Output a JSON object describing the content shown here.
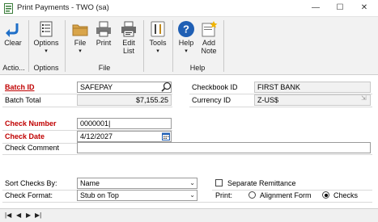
{
  "window": {
    "title": "Print Payments  -  TWO (sa)",
    "minimize": "—",
    "maximize": "☐",
    "close": "✕"
  },
  "ribbon": {
    "clear": "Clear",
    "options": "Options",
    "file": "File",
    "print": "Print",
    "edit_list": "Edit\nList",
    "tools": "Tools",
    "help": "Help",
    "add_note": "Add\nNote",
    "groups": {
      "actions": "Actio...",
      "options": "Options",
      "file": "File",
      "help": "Help"
    }
  },
  "form": {
    "batch_id_label": "Batch ID",
    "batch_id_value": "SAFEPAY",
    "batch_total_label": "Batch Total",
    "batch_total_value": "$7,155.25",
    "checkbook_id_label": "Checkbook ID",
    "checkbook_id_value": "FIRST BANK",
    "currency_id_label": "Currency ID",
    "currency_id_value": "Z-US$",
    "check_number_label": "Check Number",
    "check_number_value": "0000001|",
    "check_date_label": "Check Date",
    "check_date_value": "4/12/2027",
    "check_comment_label": "Check Comment",
    "check_comment_value": "",
    "sort_checks_label": "Sort Checks By:",
    "sort_checks_value": "Name",
    "check_format_label": "Check Format:",
    "check_format_value": "Stub on Top",
    "separate_remittance_label": "Separate Remittance",
    "print_label": "Print:",
    "alignment_form_label": "Alignment Form",
    "checks_label": "Checks",
    "print_selected": "checks"
  },
  "colors": {
    "required_label": "#c00000",
    "ribbon_bg": "#f2f2f2",
    "help_blue": "#1f5fb4"
  },
  "icons": [
    "app-icon",
    "clear-icon",
    "options-icon",
    "file-icon",
    "print-icon",
    "edit-list-icon",
    "tools-icon",
    "help-icon",
    "add-note-icon",
    "lookup-icon",
    "calendar-icon",
    "currency-expand-icon",
    "dropdown-icon",
    "nav-first-icon",
    "nav-prev-icon",
    "nav-next-icon",
    "nav-last-icon"
  ]
}
